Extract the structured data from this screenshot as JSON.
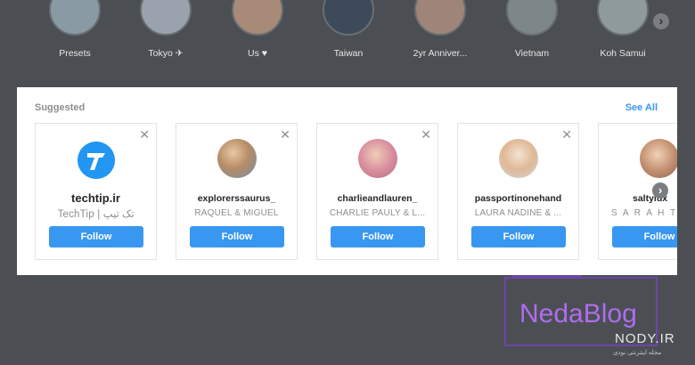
{
  "highlights": [
    {
      "label": "Presets",
      "color": "#8a9aa5"
    },
    {
      "label": "Tokyo ✈",
      "color": "#9aa3ad"
    },
    {
      "label": "Us ♥",
      "color": "#a88a78"
    },
    {
      "label": "Taiwan",
      "color": "#3d4a5a"
    },
    {
      "label": "2yr Anniver...",
      "color": "#9e8578"
    },
    {
      "label": "Vietnam",
      "color": "#7d8688"
    },
    {
      "label": "Koh Samui",
      "color": "#8f9a9c"
    }
  ],
  "highlights_next_icon": "chevron-right-icon",
  "suggested": {
    "title": "Suggested",
    "see_all": "See All",
    "cards": [
      {
        "username": "techtip.ir",
        "fullname": "TechTip | تک تیپ",
        "follow": "Follow",
        "avatar": "techtip-logo"
      },
      {
        "username": "explorerssaurus_",
        "fullname": "RAQUEL & MIGUEL",
        "follow": "Follow",
        "avatar": "#c9a583"
      },
      {
        "username": "charlieandlauren_",
        "fullname": "CHARLIE PAULY & L...",
        "follow": "Follow",
        "avatar": "#d9a4b0"
      },
      {
        "username": "passportinonehand",
        "fullname": "LAURA NADINE & ...",
        "follow": "Follow",
        "avatar": "#e3cdb9"
      },
      {
        "username": "saltylux",
        "fullname": "S A R A H  T F",
        "follow": "Follow",
        "avatar": "#c08c6c"
      }
    ],
    "close_icon": "close-icon",
    "next_icon": "chevron-right-icon"
  },
  "watermark": {
    "brand": "NedaBlog",
    "site": "NODY.IR",
    "sub": "مجله اینترنتی نودی"
  },
  "colors": {
    "accent": "#3897f0",
    "backdrop": "#4b4f53",
    "watermark": "#b06cf0"
  }
}
